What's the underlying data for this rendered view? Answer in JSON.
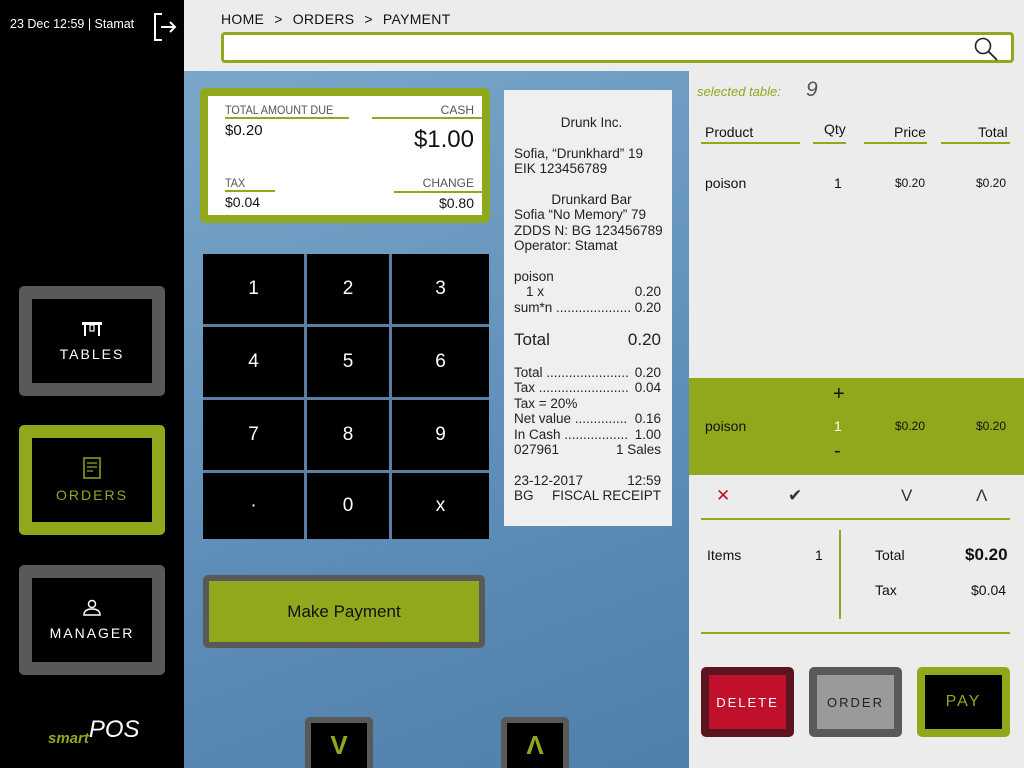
{
  "status": {
    "datetime_user": "23 Dec 12:59 | Stamat"
  },
  "sidebar": {
    "items": [
      {
        "label": "TABLES",
        "icon": "table-icon"
      },
      {
        "label": "ORDERS",
        "icon": "document-icon"
      },
      {
        "label": "MANAGER",
        "icon": "person-icon"
      }
    ],
    "logo_smart": "smart",
    "logo_pos": "POS"
  },
  "breadcrumb": {
    "items": [
      "HOME",
      "ORDERS",
      "PAYMENT"
    ],
    "separator": ">"
  },
  "search": {
    "value": "",
    "placeholder": ""
  },
  "payment": {
    "total_label": "TOTAL AMOUNT DUE",
    "total_value": "$0.20",
    "cash_label": "CASH",
    "cash_value": "$1.00",
    "tax_label": "TAX",
    "tax_value": "$0.04",
    "change_label": "CHANGE",
    "change_value": "$0.80"
  },
  "keypad": {
    "keys": [
      "1",
      "2",
      "3",
      "4",
      "5",
      "6",
      "7",
      "8",
      "9",
      "·",
      "0",
      "x"
    ]
  },
  "make_payment_label": "Make Payment",
  "scroll": {
    "down": "V",
    "up": "Λ"
  },
  "receipt": {
    "company": "Drunk Inc.",
    "address1": "Sofia, “Drunkhard” 19",
    "eik": "EIK 123456789",
    "venue": "Drunkard Bar",
    "address2": "Sofia “No Memory” 79",
    "zdds": "ZDDS N: BG 123456789",
    "operator": "Operator: Stamat",
    "item_name": "poison",
    "item_qty": "1 x",
    "item_unit_price": "0.20",
    "item_sum_label": "sum*n ....................",
    "item_sum": "0.20",
    "total_label": "Total",
    "total_value": "0.20",
    "lines": [
      {
        "label": "Total ......................",
        "value": "0.20"
      },
      {
        "label": "Tax ........................",
        "value": "0.04"
      },
      {
        "label": "Tax = 20%",
        "value": ""
      },
      {
        "label": "Net value ..............",
        "value": "0.16"
      },
      {
        "label": "In Cash .................",
        "value": "1.00"
      },
      {
        "label": "027961",
        "value": "1  Sales"
      }
    ],
    "date": "23-12-2017",
    "time": "12:59",
    "country": "BG",
    "receipt_type": "FISCAL RECEIPT"
  },
  "order": {
    "selected_table_label": "selected table:",
    "selected_table_value": "9",
    "columns": [
      "Product",
      "Qty",
      "Price",
      "Total"
    ],
    "rows": [
      {
        "product": "poison",
        "qty": "1",
        "price": "$0.20",
        "total": "$0.20"
      }
    ],
    "selected_row": {
      "product": "poison",
      "qty": "1",
      "price": "$0.20",
      "total": "$0.20",
      "plus": "+",
      "minus": "-"
    },
    "controls": {
      "remove": "✕",
      "confirm": "✔",
      "down": "V",
      "up": "Λ"
    },
    "summary": {
      "items_label": "Items",
      "items_value": "1",
      "total_label": "Total",
      "total_value": "$0.20",
      "tax_label": "Tax",
      "tax_value": "$0.04"
    }
  },
  "actions": {
    "delete": "DELETE",
    "order": "ORDER",
    "pay": "PAY"
  },
  "colors": {
    "accent": "#8fa81c",
    "delete": "#c0102c",
    "sidebar": "#000000",
    "panel": "#5f8fb8"
  }
}
